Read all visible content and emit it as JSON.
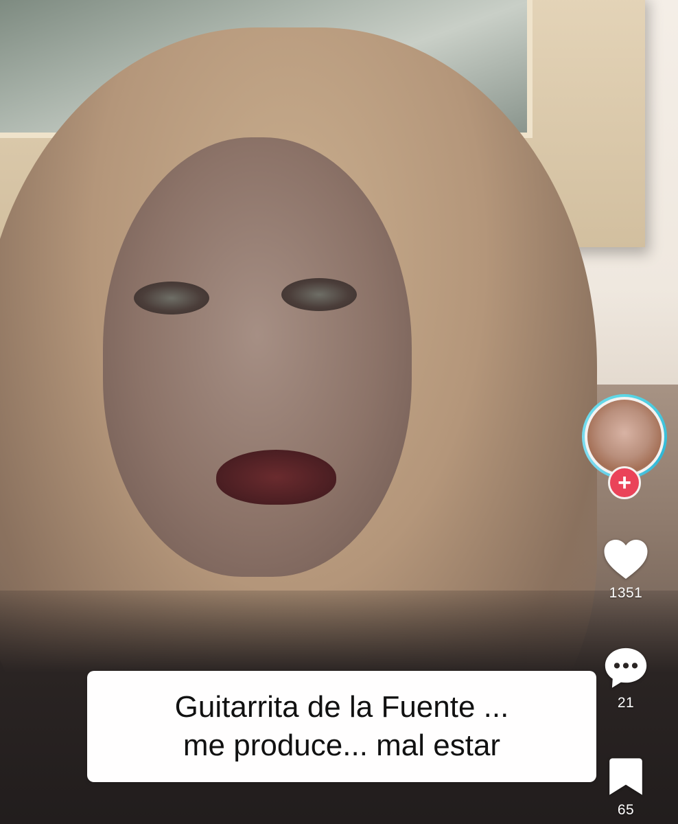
{
  "video": {
    "caption_lines": [
      "Guitarrita de la Fuente ...",
      "me produce... mal estar"
    ]
  },
  "side_actions": {
    "follow_symbol": "+",
    "likes": "1351",
    "comments": "21",
    "saves": "65"
  },
  "icons": {
    "like": "heart-icon",
    "comment": "comment-bubble-icon",
    "save": "bookmark-icon",
    "follow": "plus-icon"
  },
  "colors": {
    "avatar_ring": "#5bd7e6",
    "follow_button": "#ea4359",
    "caption_bg": "#ffffff",
    "caption_text": "#111111",
    "icon_fill": "#ffffff"
  }
}
